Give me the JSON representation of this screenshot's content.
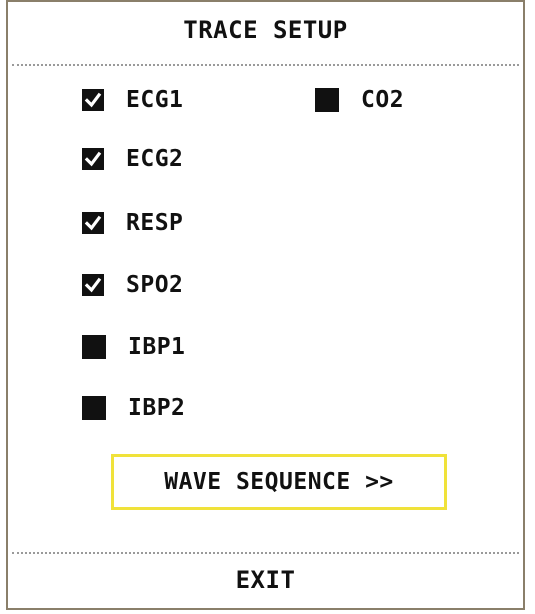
{
  "dialog": {
    "title": "TRACE SETUP",
    "options": [
      {
        "label": "ECG1",
        "checked": true
      },
      {
        "label": "ECG2",
        "checked": true
      },
      {
        "label": "RESP",
        "checked": true
      },
      {
        "label": "SPO2",
        "checked": true
      },
      {
        "label": "IBP1",
        "checked": false
      },
      {
        "label": "IBP2",
        "checked": false
      },
      {
        "label": "CO2",
        "checked": false
      }
    ],
    "wave_sequence_label": "WAVE SEQUENCE >>",
    "exit_label": "EXIT"
  },
  "colors": {
    "border": "#8a7f6a",
    "focus_outline": "#f0e23a",
    "text": "#111111"
  }
}
